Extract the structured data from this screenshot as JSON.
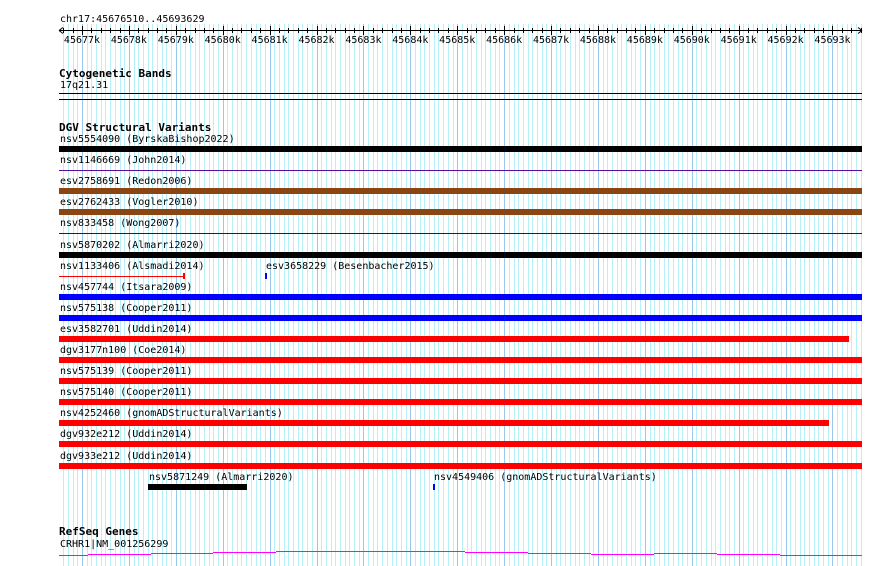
{
  "location": "chr17:45676510..45693629",
  "view": {
    "start": 45676510,
    "end": 45693629
  },
  "ruler": {
    "ticks": [
      "45677k",
      "45678k",
      "45679k",
      "45680k",
      "45681k",
      "45682k",
      "45683k",
      "45684k",
      "45685k",
      "45686k",
      "45687k",
      "45688k",
      "45689k",
      "45690k",
      "45691k",
      "45692k",
      "45693k"
    ]
  },
  "cytobands": {
    "title": "Cytogenetic Bands",
    "band": "17q21.31"
  },
  "dgv": {
    "title": "DGV Structural Variants",
    "features": [
      {
        "row": 0,
        "label": "nsv5554090 (ByrskaBishop2022)",
        "color": "#000000",
        "style": "thick",
        "start": 45676510,
        "end": 45693629
      },
      {
        "row": 1,
        "label": "nsv1146669 (John2014)",
        "color": "#5a0c9c",
        "style": "thin",
        "start": 45676510,
        "end": 45693629
      },
      {
        "row": 2,
        "label": "esv2758691 (Redon2006)",
        "color": "#8b4513",
        "style": "thick",
        "start": 45676510,
        "end": 45693629
      },
      {
        "row": 3,
        "label": "esv2762433 (Vogler2010)",
        "color": "#8b4513",
        "style": "thick",
        "start": 45676510,
        "end": 45693629
      },
      {
        "row": 4,
        "label": "nsv833458 (Wong2007)",
        "color": "#1a0c9c",
        "style": "thin",
        "start": 45676510,
        "end": 45693629
      },
      {
        "row": 5,
        "label": "nsv5870202 (Almarri2020)",
        "color": "#000000",
        "style": "thick",
        "start": 45676510,
        "end": 45693629
      },
      {
        "row": 6,
        "label": "nsv1133406 (Alsmadi2014)",
        "color": "#ff0000",
        "style": "thinend",
        "start": 45676510,
        "end": 45679175
      },
      {
        "row": 6,
        "label": "esv3658229 (Besenbacher2015)",
        "color": "#0000ff",
        "style": "tick",
        "start": 45680900,
        "end": 45680940
      },
      {
        "row": 7,
        "label": "nsv457744 (Itsara2009)",
        "color": "#0000ff",
        "style": "thick",
        "start": 45676510,
        "end": 45693629
      },
      {
        "row": 8,
        "label": "nsv575138 (Cooper2011)",
        "color": "#0000ff",
        "style": "thick",
        "start": 45676510,
        "end": 45693629
      },
      {
        "row": 9,
        "label": "esv3582701 (Uddin2014)",
        "color": "#ff0000",
        "style": "thick",
        "start": 45676510,
        "end": 45693354
      },
      {
        "row": 10,
        "label": "dgv3177n100 (Coe2014)",
        "color": "#ff0000",
        "style": "thick",
        "start": 45676510,
        "end": 45693629
      },
      {
        "row": 11,
        "label": "nsv575139 (Cooper2011)",
        "color": "#ff0000",
        "style": "thick",
        "start": 45676510,
        "end": 45693629
      },
      {
        "row": 12,
        "label": "nsv575140 (Cooper2011)",
        "color": "#ff0000",
        "style": "thick",
        "start": 45676510,
        "end": 45693629
      },
      {
        "row": 13,
        "label": "nsv4252460 (gnomADStructuralVariants)",
        "color": "#ff0000",
        "style": "thick",
        "start": 45676510,
        "end": 45692928
      },
      {
        "row": 14,
        "label": "dgv932e212 (Uddin2014)",
        "color": "#ff0000",
        "style": "thick",
        "start": 45676510,
        "end": 45693629
      },
      {
        "row": 15,
        "label": "dgv933e212 (Uddin2014)",
        "color": "#ff0000",
        "style": "thick",
        "start": 45676510,
        "end": 45693629
      },
      {
        "row": 16,
        "label": "nsv5871249 (Almarri2020)",
        "color": "#000000",
        "style": "thick",
        "start": 45678408,
        "end": 45680519
      },
      {
        "row": 16,
        "label": "nsv4549406 (gnomADStructuralVariants)",
        "color": "#0000ff",
        "style": "tick",
        "start": 45684484,
        "end": 45684520
      }
    ]
  },
  "refseq": {
    "title": "RefSeq Genes",
    "gene": "CRHR1|NM_001256299",
    "color": "#ff00ff"
  },
  "colors": {
    "grid_minor": "#b8f0f8",
    "grid_major": "#9ac8ec"
  }
}
